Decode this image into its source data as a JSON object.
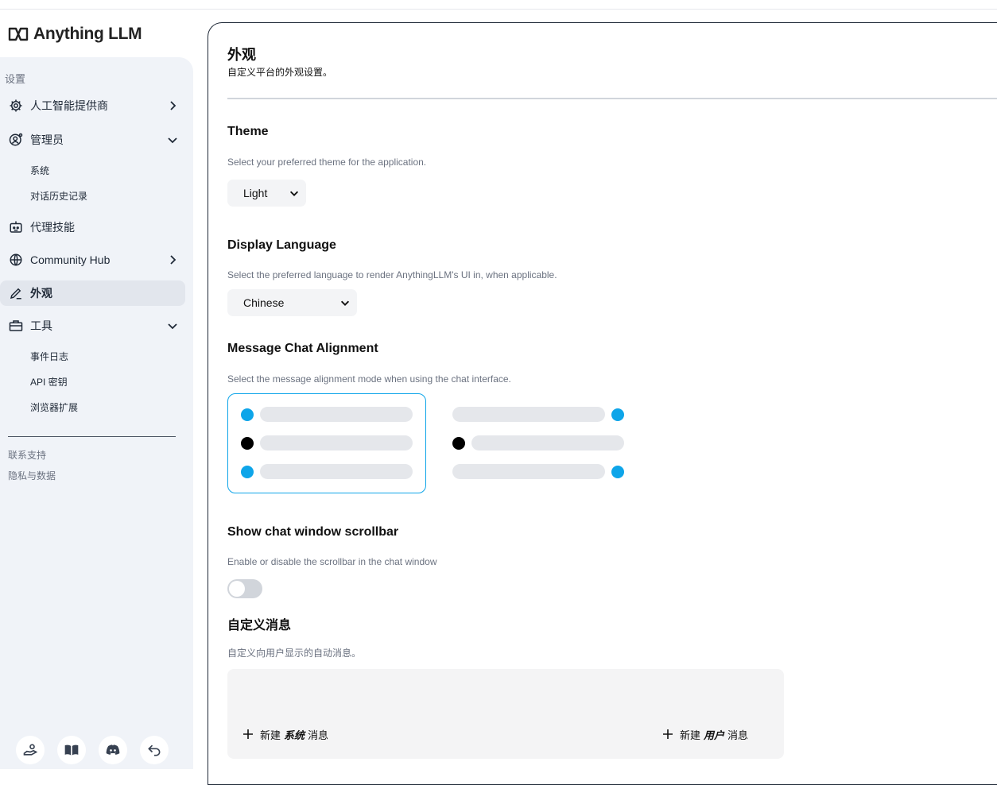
{
  "app": {
    "logo_text": "Anything LLM"
  },
  "sidebar": {
    "heading": "设置",
    "items": [
      {
        "label": "人工智能提供商",
        "icon": "gear-icon",
        "expanded": false
      },
      {
        "label": "管理员",
        "icon": "user-gear-icon",
        "expanded": true,
        "children": [
          "系统",
          "对话历史记录"
        ]
      },
      {
        "label": "代理技能",
        "icon": "robot-icon"
      },
      {
        "label": "Community Hub",
        "icon": "globe-icon",
        "expanded": false
      },
      {
        "label": "外观",
        "icon": "pencil-icon",
        "active": true
      },
      {
        "label": "工具",
        "icon": "toolbox-icon",
        "expanded": true,
        "children": [
          "事件日志",
          "API 密钥",
          "浏览器扩展"
        ]
      }
    ],
    "footer_links": [
      "联系支持",
      "隐私与数据"
    ],
    "bottom_icons": [
      "hand-coins-icon",
      "book-icon",
      "discord-icon",
      "return-icon"
    ]
  },
  "page": {
    "title": "外观",
    "subtitle": "自定义平台的外观设置。",
    "theme": {
      "title": "Theme",
      "description": "Select your preferred theme for the application.",
      "value": "Light"
    },
    "language": {
      "title": "Display Language",
      "description": "Select the preferred language to render AnythingLLM's UI in, when applicable.",
      "value": "Chinese"
    },
    "alignment": {
      "title": "Message Chat Alignment",
      "description": "Select the message alignment mode when using the chat interface.",
      "options": [
        "left",
        "left-right"
      ],
      "selected": "left"
    },
    "scrollbar": {
      "title": "Show chat window scrollbar",
      "description": "Enable or disable the scrollbar in the chat window",
      "enabled": false
    },
    "custom_messages": {
      "title": "自定义消息",
      "description": "自定义向用户显示的自动消息。",
      "new_system": {
        "prefix": "新建",
        "role": "系统",
        "suffix": "消息"
      },
      "new_user": {
        "prefix": "新建",
        "role": "用户",
        "suffix": "消息"
      }
    }
  },
  "colors": {
    "accent": "#0ea5e9",
    "sidebar_bg": "#f0f3f8",
    "active_item_bg": "#e2e6ed"
  }
}
